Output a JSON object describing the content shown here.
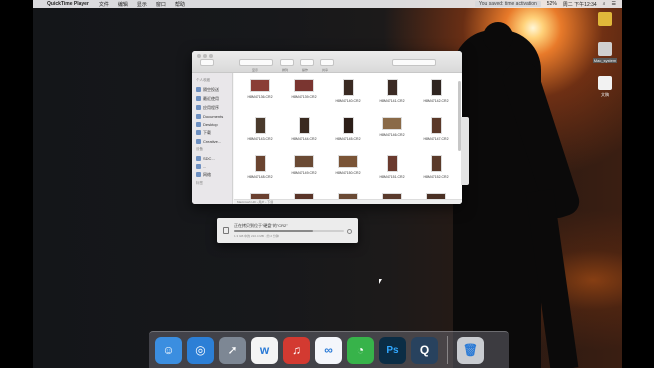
{
  "menubar": {
    "app_name": "QuickTime Player",
    "items": [
      "文件",
      "编辑",
      "显示",
      "窗口",
      "帮助"
    ],
    "notification": "You saved: time activation",
    "battery": "52%",
    "clock": "周二 下午12:34"
  },
  "desktop": {
    "icons": [
      {
        "label": "",
        "color": "#e0b83a"
      },
      {
        "label": "Mac_system",
        "color": "#d0d0d0"
      },
      {
        "label": "文稿",
        "color": "#f2f2f2"
      }
    ]
  },
  "finder": {
    "title": "",
    "toolbar_labels": [
      "显示",
      "排列",
      "操作",
      "共享"
    ],
    "sidebar": {
      "favorites_heading": "个人收藏",
      "favorites": [
        "隔空投送",
        "最近使用",
        "应用程序",
        "Documents",
        "Desktop",
        "下载",
        "Creative..."
      ],
      "devices_heading": "设备",
      "devices": [
        "SDC...",
        "...",
        "网络"
      ],
      "tags_heading": "标签"
    },
    "files": [
      {
        "name": "H8M47136.CR2",
        "shape": "land",
        "color": "#8a3d36"
      },
      {
        "name": "H8M47139.CR2",
        "shape": "land",
        "color": "#7a3530"
      },
      {
        "name": "H8M47140.CR2",
        "shape": "port",
        "color": "#3a2a22"
      },
      {
        "name": "H8M47141.CR2",
        "shape": "port",
        "color": "#3b2b24"
      },
      {
        "name": "H8M47142.CR2",
        "shape": "port",
        "color": "#2f2520"
      },
      {
        "name": "H8M47143.CR2",
        "shape": "port",
        "color": "#4a3a2c"
      },
      {
        "name": "H8M47144.CR2",
        "shape": "port",
        "color": "#3a2a20"
      },
      {
        "name": "H8M47145.CR2",
        "shape": "port",
        "color": "#2c1e18"
      },
      {
        "name": "H8M47146.CR2",
        "shape": "land",
        "color": "#8a6a48"
      },
      {
        "name": "H8M47147.CR2",
        "shape": "port",
        "color": "#5a3828"
      },
      {
        "name": "H8M47148.CR2",
        "shape": "port",
        "color": "#6a4430"
      },
      {
        "name": "H8M47149.CR2",
        "shape": "land",
        "color": "#6a4a34"
      },
      {
        "name": "H8M47150.CR2",
        "shape": "land",
        "color": "#7a5436"
      },
      {
        "name": "H8M47151.CR2",
        "shape": "port",
        "color": "#6a3a2e"
      },
      {
        "name": "H8M47152.CR2",
        "shape": "port",
        "color": "#5a3a2a"
      },
      {
        "name": "",
        "shape": "land",
        "color": "#6a4030"
      },
      {
        "name": "",
        "shape": "land",
        "color": "#5a3428"
      },
      {
        "name": "",
        "shape": "land",
        "color": "#6a4a34"
      },
      {
        "name": "",
        "shape": "land",
        "color": "#5a3a2c"
      },
      {
        "name": "",
        "shape": "land",
        "color": "#4a3024"
      }
    ],
    "path_text": "Macintosh HD › 用户 › 下载"
  },
  "progress": {
    "title": "正在拷贝到位于\"硬盘\"的\"CR2\"",
    "status": "1.3 GB 中的 210.4 MB · 约 2 分钟",
    "fraction": 0.72
  },
  "dock": {
    "apps": [
      {
        "name": "finder-icon",
        "glyph": "☺",
        "color": "#3b8ee0"
      },
      {
        "name": "safari-icon",
        "glyph": "◎",
        "color": "#2c7fd6"
      },
      {
        "name": "launchpad-icon",
        "glyph": "➚",
        "color": "#7d8794"
      },
      {
        "name": "wunderlist-icon",
        "glyph": "w",
        "color": "#f4f4f4"
      },
      {
        "name": "netease-music-icon",
        "glyph": "♫",
        "color": "#d33a31"
      },
      {
        "name": "baidu-netdisk-icon",
        "glyph": "∞",
        "color": "#f4f6fb"
      },
      {
        "name": "wechat-icon",
        "glyph": "◔",
        "color": "#37b34a"
      },
      {
        "name": "photoshop-icon",
        "glyph": "Ps",
        "color": "#0b2d45"
      },
      {
        "name": "quicktime-icon",
        "glyph": "Q",
        "color": "#28425e"
      },
      {
        "name": "trash-icon",
        "glyph": "🗑",
        "color": "#c9ccd1"
      }
    ]
  }
}
